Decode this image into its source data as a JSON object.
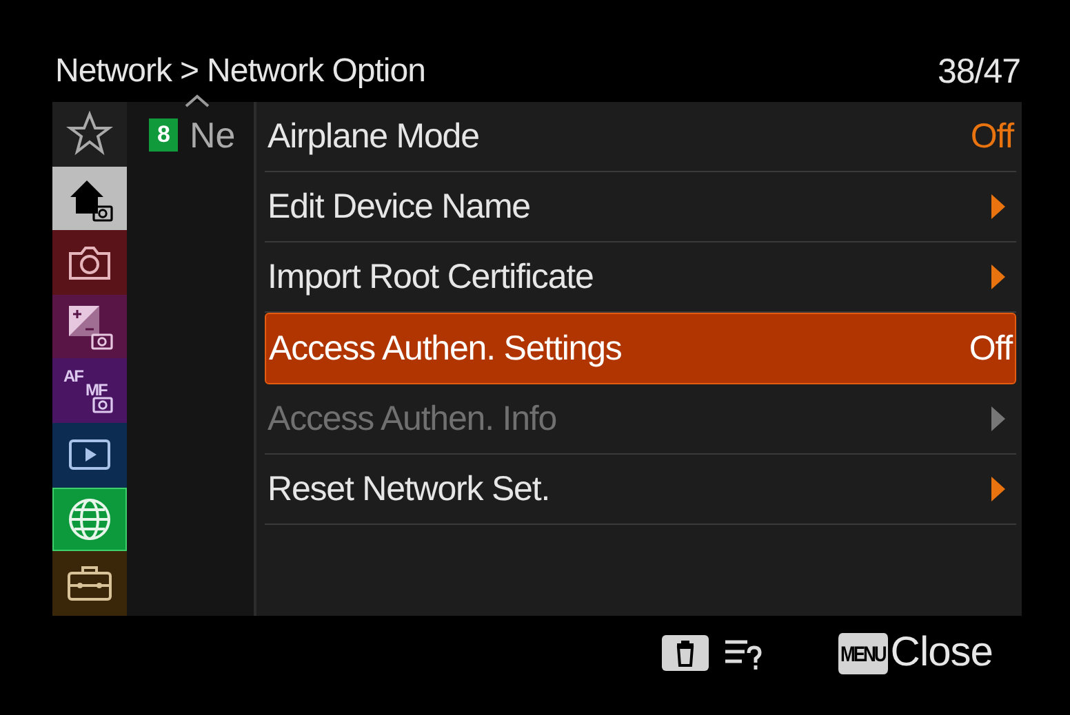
{
  "header": {
    "breadcrumb_parent": "Network",
    "separator": ">",
    "title": "Network Option",
    "page_count": "38/47"
  },
  "tabs": [
    {
      "kind": "star",
      "color": "#1f1f1f",
      "selected": false
    },
    {
      "kind": "home",
      "color": "#bdbdbd",
      "selected": false
    },
    {
      "kind": "camera",
      "color": "#5a1419",
      "selected": false
    },
    {
      "kind": "exposure",
      "color": "#5a1547",
      "selected": false
    },
    {
      "kind": "focus",
      "labels": [
        "AF",
        "MF"
      ],
      "color": "#4a1664",
      "selected": false
    },
    {
      "kind": "play",
      "color": "#0c2c52",
      "selected": false
    },
    {
      "kind": "globe",
      "color": "#0c9a3c",
      "selected": true
    },
    {
      "kind": "toolbox",
      "color": "#3a2608",
      "selected": false
    }
  ],
  "group": {
    "number": "8",
    "label": "Ne"
  },
  "rows": [
    {
      "label": "Airplane Mode",
      "kind": "value",
      "value": "Off",
      "selected": false,
      "disabled": false
    },
    {
      "label": "Edit Device Name",
      "kind": "arrow",
      "selected": false,
      "disabled": false
    },
    {
      "label": "Import Root Certificate",
      "kind": "arrow",
      "selected": false,
      "disabled": false
    },
    {
      "label": "Access Authen. Settings",
      "kind": "value",
      "value": "Off",
      "selected": true,
      "disabled": false
    },
    {
      "label": "Access Authen. Info",
      "kind": "arrow",
      "selected": false,
      "disabled": true
    },
    {
      "label": "Reset Network Set.",
      "kind": "arrow",
      "selected": false,
      "disabled": false
    }
  ],
  "footer": {
    "menu_key": "MENU",
    "close_label": "Close"
  }
}
